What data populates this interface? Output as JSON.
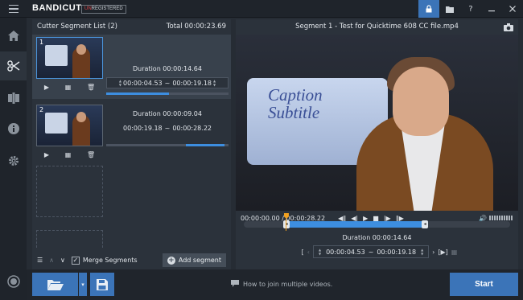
{
  "app": {
    "brand_left": "BANDI",
    "brand_right": "CUT",
    "badge_un": "UN",
    "badge_rest": "REGISTERED",
    "icons": [
      "lock-icon",
      "folder-icon",
      "help-icon",
      "minimize-icon",
      "close-icon"
    ]
  },
  "rail": {
    "items": [
      "menu-icon",
      "home-icon",
      "cut-icon",
      "join-icon",
      "info-icon",
      "settings-icon",
      "record-icon"
    ]
  },
  "segments_panel": {
    "title": "Cutter Segment List (2)",
    "total": "Total 00:00:23.69",
    "segments": [
      {
        "number": "1",
        "duration": "Duration 00:00:14.64",
        "start": "00:00:04.53",
        "sep": "~",
        "end": "00:00:19.18",
        "progress": 0.51,
        "offset": 0.0
      },
      {
        "number": "2",
        "duration": "Duration 00:00:09.04",
        "start": "00:00:19.18",
        "sep": "~",
        "end": "00:00:28.22",
        "progress": 0.32,
        "offset": 0.65
      }
    ],
    "merge_label": "Merge Segments",
    "merge_checked": "✓",
    "add_label": "Add segment"
  },
  "video_panel": {
    "title": "Segment 1 - Test for Quicktime 608 CC file.mp4",
    "board_text": "Caption Subtitle",
    "time": "00:00:00.00 / 00:00:28.22",
    "selection_duration": "Duration 00:00:14.64",
    "selection_start": "00:00:04.53",
    "selection_sep": "~",
    "selection_end": "00:00:19.18",
    "sel_start_frac": 0.16,
    "sel_end_frac": 0.68,
    "playhead_frac": 0.16
  },
  "bottom": {
    "hint": "How to join multiple videos.",
    "start_label": "Start"
  },
  "colors": {
    "accent": "#3b74b8",
    "progress": "#3d8ee0",
    "playhead": "#f0a020",
    "unregistered": "#e04848"
  }
}
